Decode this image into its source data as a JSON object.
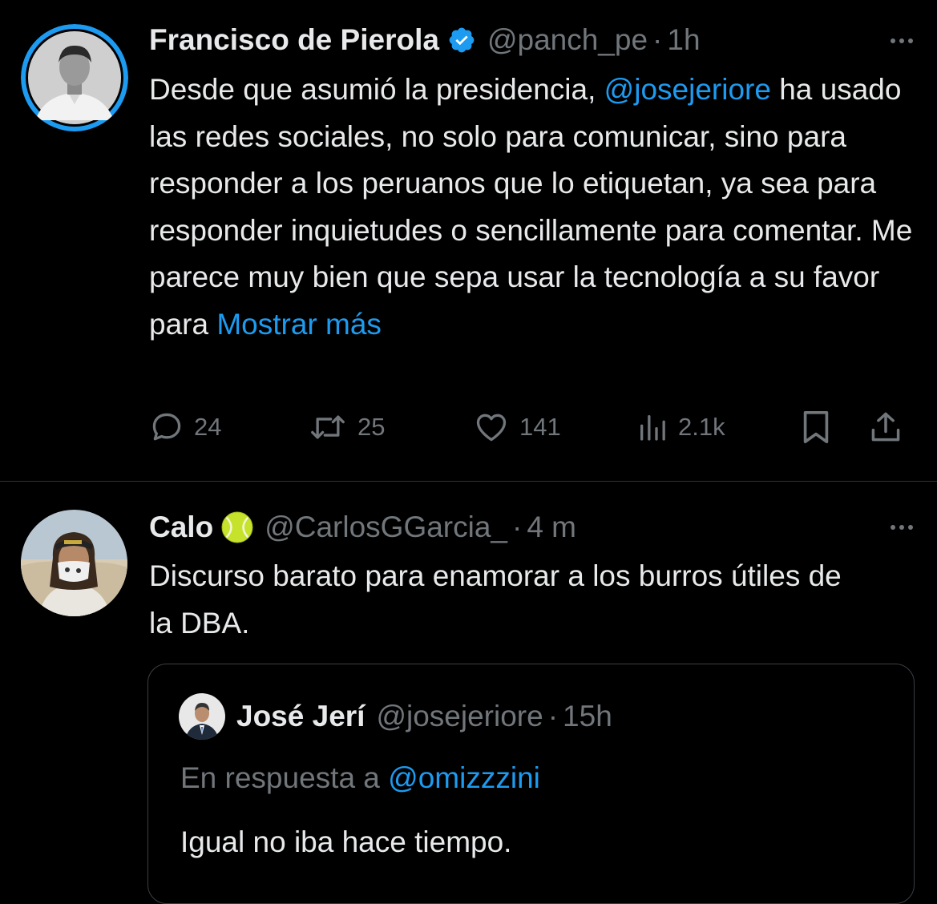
{
  "colors": {
    "background": "#000000",
    "text": "#e7e9ea",
    "muted": "#71767b",
    "link": "#1d9bf0",
    "verified": "#1d9bf0",
    "divider": "#2f3336"
  },
  "tweet1": {
    "author_name": "Francisco de Pierola",
    "verified_icon": "verified-badge-icon",
    "handle": "@panch_pe",
    "separator": "·",
    "time": "1h",
    "text_before_mention": "Desde que asumió la presidencia, ",
    "mention": "@josejeriore",
    "text_after_mention": " ha usado las redes sociales, no solo para comunicar, sino para responder a los peruanos que lo etiquetan, ya sea para responder inquietudes o sencillamente para comentar. Me parece muy bien que sepa usar la tecnología a su favor para ",
    "show_more": "Mostrar más",
    "actions": {
      "replies": "24",
      "retweets": "25",
      "likes": "141",
      "views": "2.1k"
    }
  },
  "tweet2": {
    "author_name": "Calo",
    "name_emoji_icon": "tennis-ball-icon",
    "handle": "@CarlosGGarcia_",
    "separator": "·",
    "time": "4 m",
    "text": "Discurso barato para enamorar a los burros útiles de la DBA.",
    "quote": {
      "author_name": "José Jerí",
      "handle": "@josejeriore",
      "separator": "·",
      "time": "15h",
      "reply_prefix": "En respuesta a ",
      "reply_to": "@omizzzini",
      "text": "Igual no iba hace tiempo."
    }
  }
}
